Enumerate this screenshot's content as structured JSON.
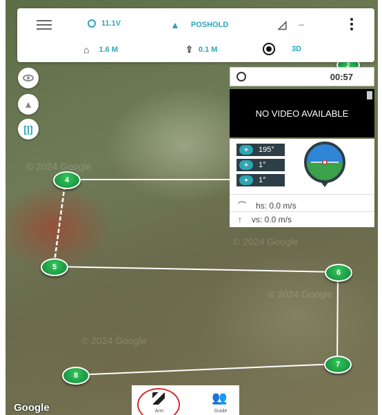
{
  "topbar": {
    "battery": "11.1V",
    "mode": "POSHOLD",
    "signal": "--",
    "altitude": "1.6 M",
    "climb": "0.1 M",
    "gps_fix": "3D"
  },
  "panel": {
    "timer": "00:57",
    "video": "NO VIDEO AVAILABLE",
    "heading": "195°",
    "pitch": "1°",
    "roll": "1°",
    "hs": "hs: 0.0 m/s",
    "vs": "vs: 0.0 m/s"
  },
  "waypoints": [
    {
      "label": "4"
    },
    {
      "label": "5"
    },
    {
      "label": "6"
    },
    {
      "label": "7"
    },
    {
      "label": "8"
    },
    {
      "label": "2"
    }
  ],
  "bottom": {
    "arm_label": "Arm",
    "guide_label": "Guide"
  },
  "map": {
    "attribution": "Google",
    "watermark": "© 2024 Google"
  },
  "colors": {
    "accent": "#2aa6b8",
    "waypoint": "#1fa84a",
    "arm_circle": "#d42a2a"
  }
}
